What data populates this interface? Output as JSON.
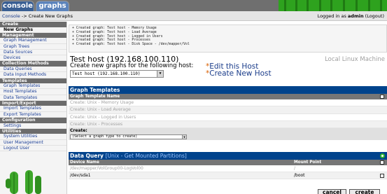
{
  "tabs": [
    {
      "label": "console"
    },
    {
      "label": "graphs"
    }
  ],
  "breadcrumb": {
    "link": "Console",
    "separator": " -> ",
    "current": "Create New Graphs"
  },
  "login": {
    "prefix": "Logged in as ",
    "user": "admin",
    "logout": " (Logout)"
  },
  "sidebar": [
    {
      "header": "Create",
      "items": [
        {
          "label": "New Graphs",
          "selected": true
        }
      ]
    },
    {
      "header": "Management",
      "items": [
        {
          "label": "Graph Management"
        },
        {
          "label": "Graph Trees"
        },
        {
          "label": "Data Sources"
        },
        {
          "label": "Devices"
        }
      ]
    },
    {
      "header": "Collection Methods",
      "items": [
        {
          "label": "Data Queries"
        },
        {
          "label": "Data Input Methods"
        }
      ]
    },
    {
      "header": "Templates",
      "items": [
        {
          "label": "Graph Templates"
        },
        {
          "label": "Host Templates"
        },
        {
          "label": "Data Templates"
        }
      ]
    },
    {
      "header": "Import/Export",
      "items": [
        {
          "label": "Import Templates"
        },
        {
          "label": "Export Templates"
        }
      ]
    },
    {
      "header": "Configuration",
      "items": [
        {
          "label": "Settings"
        }
      ]
    },
    {
      "header": "Utilities",
      "items": [
        {
          "label": "System Utilities"
        },
        {
          "label": "User Management"
        },
        {
          "label": "Logout User"
        }
      ]
    }
  ],
  "messages": [
    "+ Created graph: Test host - Memory Usage",
    "+ Created graph: Test host - Load Average",
    "+ Created graph: Test host - Logged in Users",
    "+ Created graph: Test host - Processes",
    "+ Created graph: Test host - Disk Space - /dev/mapper/Vol"
  ],
  "host": {
    "title": "Test host (192.168.100.110)",
    "subtitle": "Create new graphs for the following host:",
    "selected": "Test host (192.168.100.110)",
    "template": "Local Linux Machine",
    "edit_link": "Edit this Host",
    "new_link": "Create New Host",
    "star": "*"
  },
  "graph_templates": {
    "title": "Graph Templates",
    "column": "Graph Template Name",
    "rows": [
      "Create: Unix - Memory Usage",
      "Create: Unix - Load Average",
      "Create: Unix - Logged in Users",
      "Create: Unix - Processes"
    ],
    "create_label": "Create:",
    "create_select": "(Select a graph type to create)"
  },
  "data_query": {
    "title_prefix": "Data Query",
    "title_bracket": "[Unix - Get Mounted Partitions]",
    "columns": [
      "Device Name",
      "Mount Point"
    ],
    "rows": [
      {
        "device": "/dev/mapper/VolGroup00-LogVol00",
        "mount": "/",
        "dim": true
      },
      {
        "device": "/dev/sda1",
        "mount": "/boot",
        "dim": false
      }
    ]
  },
  "buttons": {
    "cancel": "cancel",
    "create": "create"
  },
  "colors": {
    "nav_blue": "#00438c",
    "tab_dark": "#3a5f93",
    "tab_light": "#5c84bc",
    "cactus_green": "#2ea21e",
    "link": "#1a3c8a"
  }
}
